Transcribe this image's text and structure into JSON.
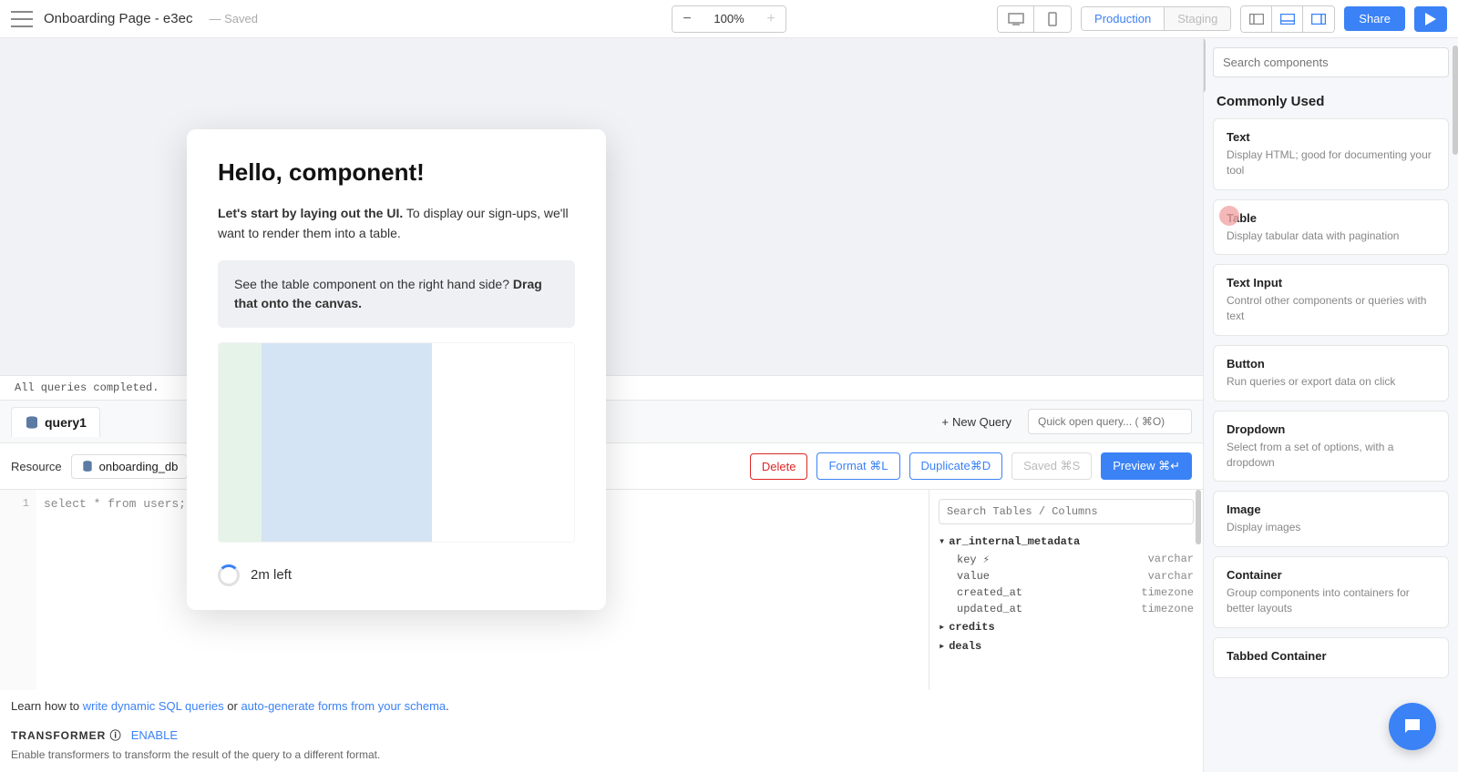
{
  "header": {
    "page_title": "Onboarding Page - e3ec",
    "saved_label": "—  Saved",
    "zoom_value": "100%",
    "env_production": "Production",
    "env_staging": "Staging",
    "share_label": "Share"
  },
  "status_bar": "All queries completed.",
  "query_tabs": {
    "active_tab": "query1",
    "new_query_label": "New Query",
    "quick_open_placeholder": "Quick open query... ( ⌘O)"
  },
  "query_toolbar": {
    "resource_label": "Resource",
    "resource_value": "onboarding_db",
    "delete_label": "Delete",
    "format_label": "Format ⌘L",
    "duplicate_label": "Duplicate⌘D",
    "saved_label": "Saved ⌘S",
    "preview_label": "Preview ⌘↵"
  },
  "editor": {
    "line_no": "1",
    "code": "select * from users;"
  },
  "schema": {
    "search_placeholder": "Search Tables / Columns",
    "tables": [
      {
        "name": "ar_internal_metadata",
        "expanded": true,
        "columns": [
          {
            "name": "key",
            "pk": true,
            "type": "varchar"
          },
          {
            "name": "value",
            "type": "varchar"
          },
          {
            "name": "created_at",
            "type": "timezone"
          },
          {
            "name": "updated_at",
            "type": "timezone"
          }
        ]
      },
      {
        "name": "credits",
        "expanded": false
      },
      {
        "name": "deals",
        "expanded": false
      }
    ]
  },
  "learn": {
    "prefix": "Learn how to ",
    "link1": "write dynamic SQL queries",
    "mid": " or ",
    "link2": "auto-generate forms from your schema",
    "suffix": "."
  },
  "transformer": {
    "label": "TRANSFORMER",
    "enable": "ENABLE",
    "desc": "Enable transformers to transform the result of the query to a different format."
  },
  "sidebar": {
    "search_placeholder": "Search components",
    "section": "Commonly Used",
    "components": [
      {
        "title": "Text",
        "desc": "Display HTML; good for documenting your tool"
      },
      {
        "title": "Table",
        "desc": "Display tabular data with pagination"
      },
      {
        "title": "Text Input",
        "desc": "Control other components or queries with text"
      },
      {
        "title": "Button",
        "desc": "Run queries or export data on click"
      },
      {
        "title": "Dropdown",
        "desc": "Select from a set of options, with a dropdown"
      },
      {
        "title": "Image",
        "desc": "Display images"
      },
      {
        "title": "Container",
        "desc": "Group components into containers for better layouts"
      },
      {
        "title": "Tabbed Container",
        "desc": ""
      }
    ]
  },
  "modal": {
    "title": "Hello, component!",
    "intro_bold": "Let's start by laying out the UI.",
    "intro_rest": " To display our sign-ups, we'll want to render them into a table.",
    "hint_prefix": "See the table component on the right hand side? ",
    "hint_bold": "Drag that onto the canvas.",
    "time_left": "2m left"
  }
}
